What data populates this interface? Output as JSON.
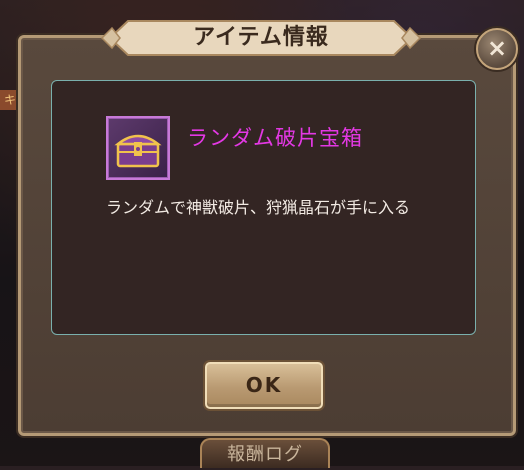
{
  "background": {
    "tab_label": "報酬ログ",
    "side_glyph": "キ"
  },
  "dialog": {
    "title": "アイテム情報",
    "close_label": "×",
    "item": {
      "name": "ランダム破片宝箱",
      "name_color": "#e338e4",
      "icon": "treasure-chest-icon",
      "description": "ランダムで神獣破片、狩猟晶石が手に入る"
    },
    "ok_label": "OK"
  },
  "colors": {
    "panel_border": "#7ab0ad",
    "frame": "#b59a76",
    "icon_border": "#c77ad8"
  }
}
